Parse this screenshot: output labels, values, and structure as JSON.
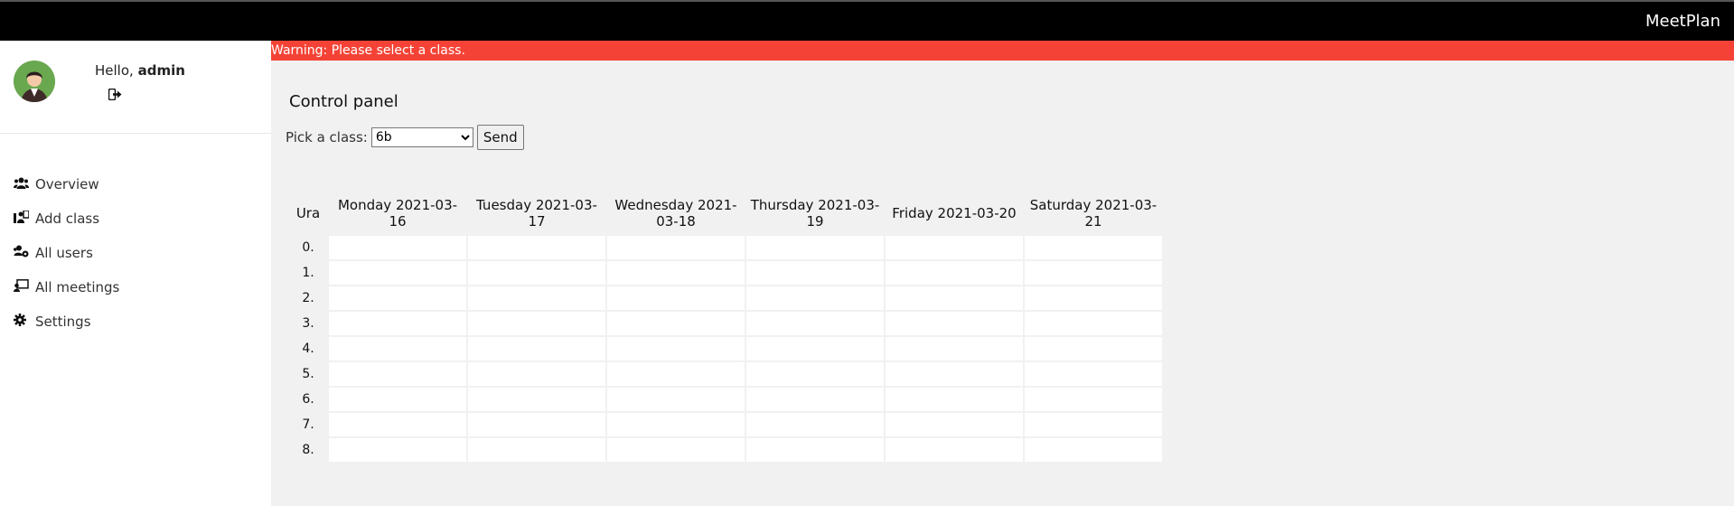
{
  "app": {
    "brand": "MeetPlan"
  },
  "user": {
    "greeting_prefix": "Hello,",
    "name": "admin"
  },
  "sidebar": {
    "items": [
      {
        "label": "Overview",
        "icon": "users-icon"
      },
      {
        "label": "Add class",
        "icon": "class-icon"
      },
      {
        "label": "All users",
        "icon": "users-cog-icon"
      },
      {
        "label": "All meetings",
        "icon": "meetings-icon"
      },
      {
        "label": "Settings",
        "icon": "gear-icon"
      }
    ]
  },
  "banner": {
    "text": "Warning: Please select a class."
  },
  "main": {
    "title": "Control panel",
    "picker_label": "Pick a class:",
    "selected_class": "6b",
    "send_label": "Send"
  },
  "schedule": {
    "hour_header": "Ura",
    "days": [
      "Monday 2021-03-16",
      "Tuesday 2021-03-17",
      "Wednesday 2021-03-18",
      "Thursday 2021-03-19",
      "Friday 2021-03-20",
      "Saturday 2021-03-21"
    ],
    "hours": [
      "0.",
      "1.",
      "2.",
      "3.",
      "4.",
      "5.",
      "6.",
      "7.",
      "8."
    ]
  },
  "colors": {
    "banner": "#f44336",
    "topbar": "#000000",
    "sidebar": "#ffffff",
    "content": "#f1f1f1"
  }
}
